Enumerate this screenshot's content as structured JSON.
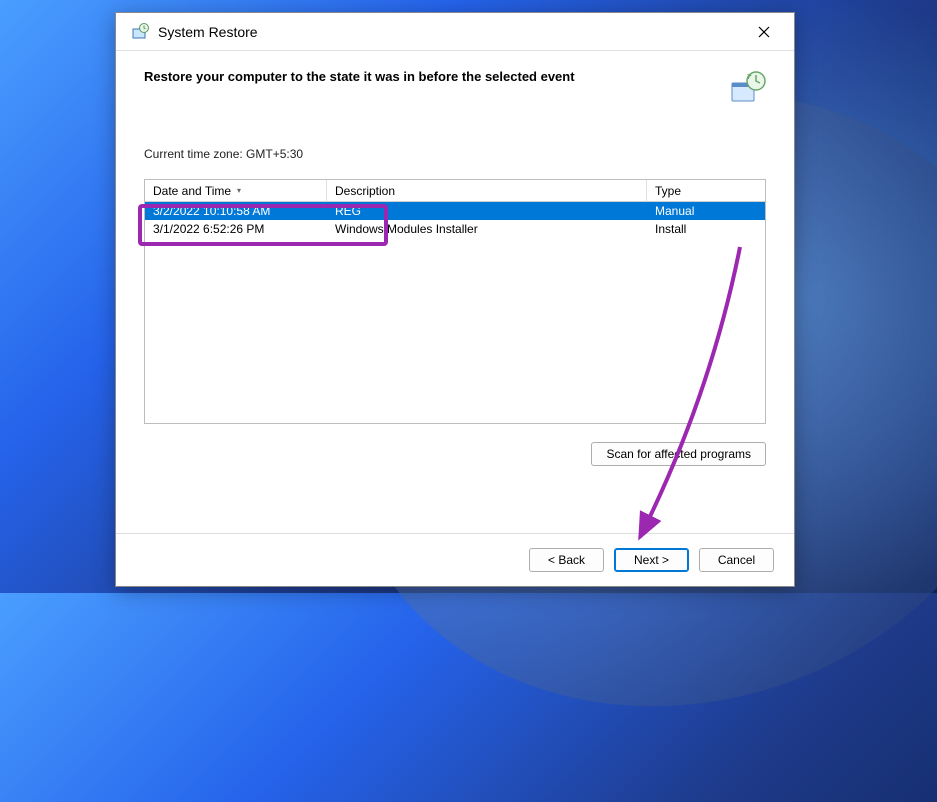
{
  "window": {
    "title": "System Restore"
  },
  "heading": "Restore your computer to the state it was in before the selected event",
  "timezone": "Current time zone: GMT+5:30",
  "columns": {
    "datetime": "Date and Time",
    "description": "Description",
    "type": "Type"
  },
  "rows": [
    {
      "datetime": "3/2/2022 10:10:58 AM",
      "description": "REG",
      "type": "Manual",
      "selected": true
    },
    {
      "datetime": "3/1/2022 6:52:26 PM",
      "description": "Windows Modules Installer",
      "type": "Install",
      "selected": false
    }
  ],
  "buttons": {
    "scan": "Scan for affected programs",
    "back": "< Back",
    "next": "Next >",
    "cancel": "Cancel"
  }
}
